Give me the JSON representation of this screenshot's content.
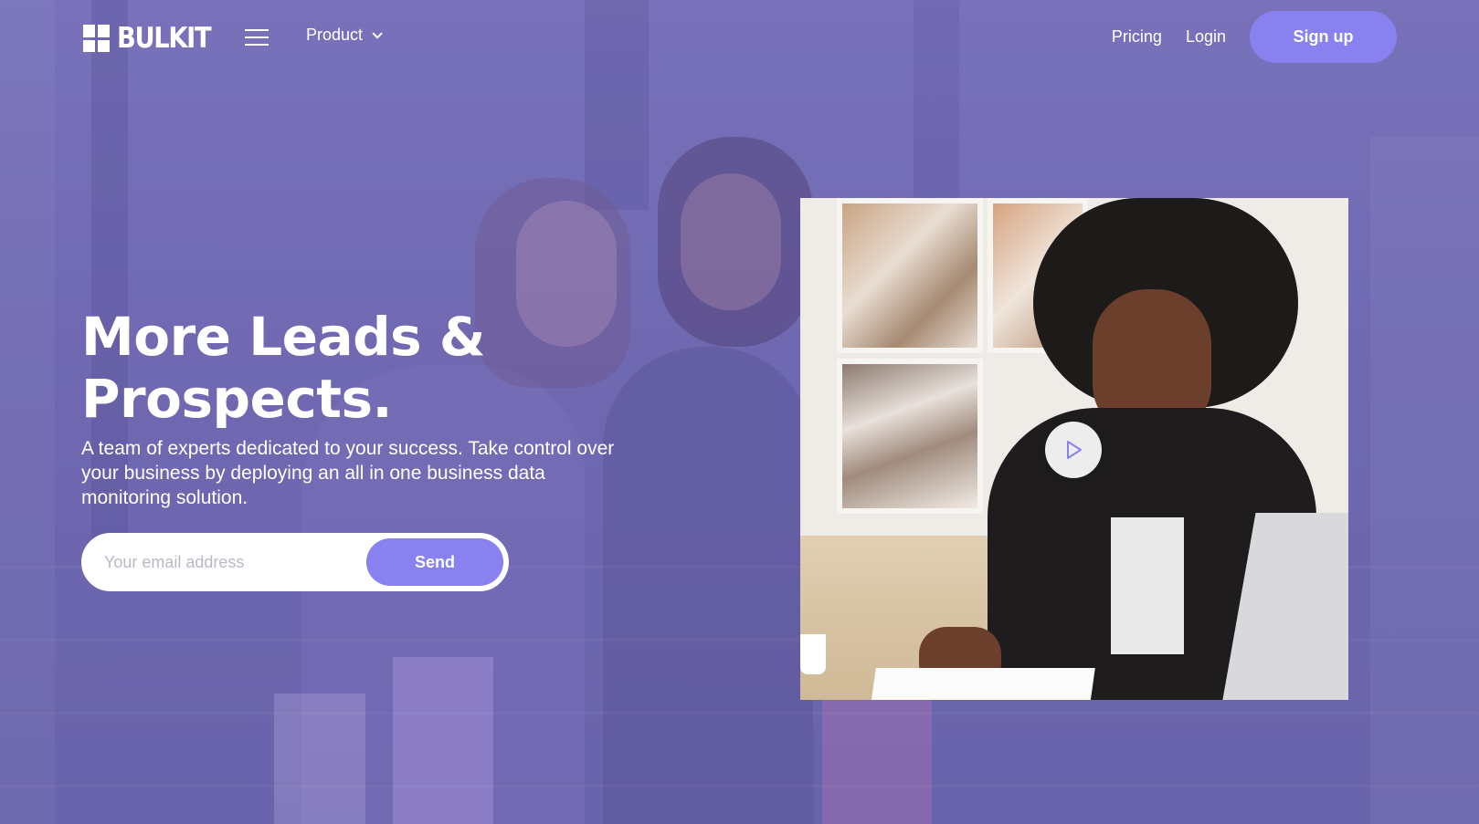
{
  "brand": {
    "name": "BULKIT"
  },
  "nav": {
    "product_label": "Product",
    "pricing_label": "Pricing",
    "login_label": "Login",
    "signup_label": "Sign up"
  },
  "hero": {
    "title_line1": "More Leads &",
    "title_line2": "Prospects.",
    "subtitle": "A team of experts dedicated to your success. Take control over your business by deploying an all in one business data monitoring solution.",
    "email_placeholder": "Your email address",
    "send_label": "Send"
  },
  "colors": {
    "accent": "#8881ef",
    "overlay": "#6f6aa8",
    "text": "#ffffff"
  },
  "icons": {
    "logo": "grid-logo-icon",
    "menu": "hamburger-icon",
    "dropdown": "chevron-down-icon",
    "video": "play-icon"
  }
}
